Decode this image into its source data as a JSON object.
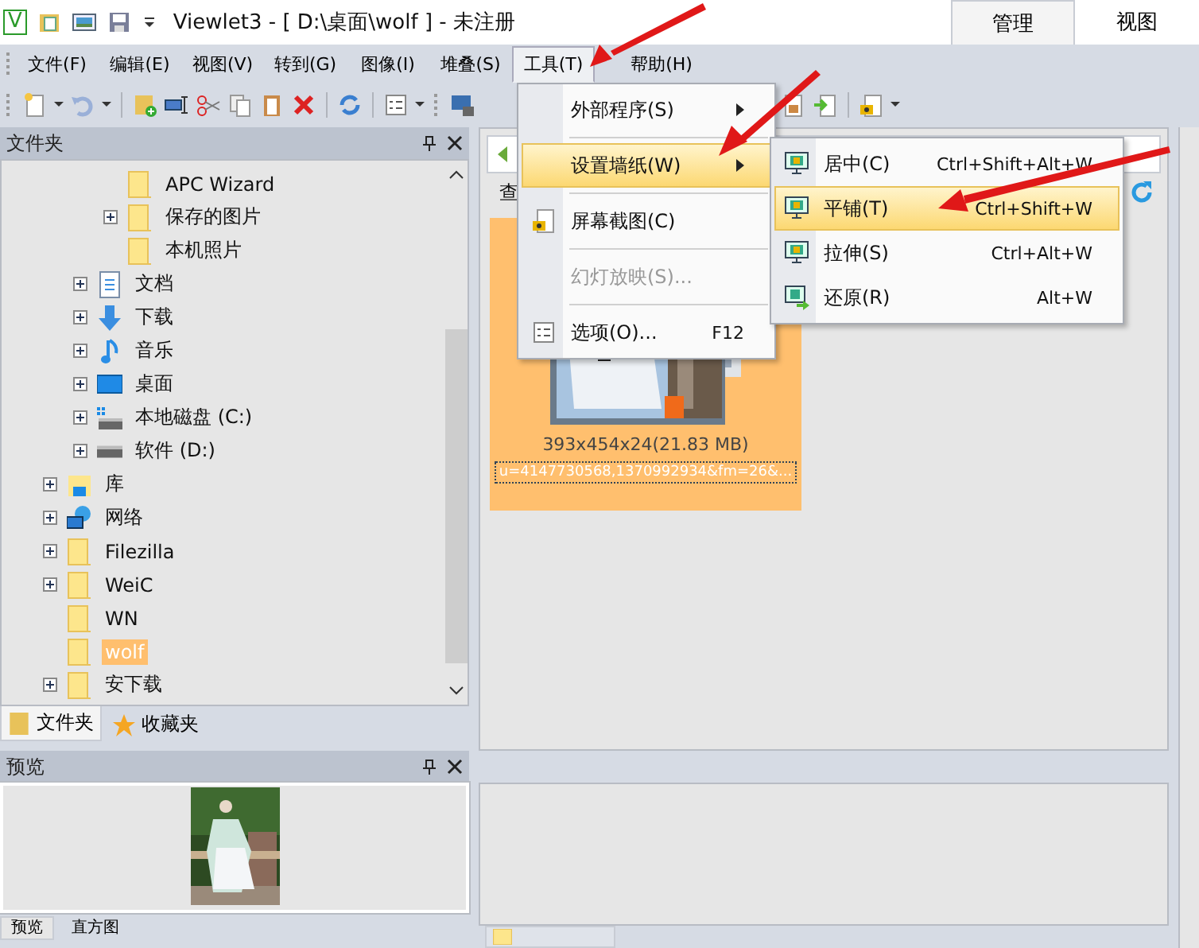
{
  "title_bar": {
    "logo": "V",
    "title": "Viewlet3 - [ D:\\桌面\\wolf ] - 未注册",
    "ribbon_tabs": [
      {
        "label": "管理",
        "selected": true
      },
      {
        "label": "视图",
        "selected": false
      }
    ]
  },
  "menu_bar": [
    {
      "label": "文件(F)",
      "selected": false
    },
    {
      "label": "编辑(E)",
      "selected": false
    },
    {
      "label": "视图(V)",
      "selected": false
    },
    {
      "label": "转到(G)",
      "selected": false
    },
    {
      "label": "图像(I)",
      "selected": false
    },
    {
      "label": "堆叠(S)",
      "selected": false
    },
    {
      "label": "工具(T)",
      "selected": true
    },
    {
      "label": "帮助(H)",
      "selected": false
    }
  ],
  "folder_panel": {
    "title": "文件夹",
    "tree": [
      {
        "children": [
          {
            "children": [
              {
                "label": "APC Wizard",
                "kind": "folder",
                "expander": false,
                "selected": false
              },
              {
                "label": "保存的图片",
                "kind": "folder",
                "expander": true,
                "selected": false
              },
              {
                "label": "本机照片",
                "kind": "folder",
                "expander": false,
                "selected": false
              }
            ]
          },
          {
            "label": "文档",
            "kind": "document",
            "expander": true,
            "selected": false
          },
          {
            "label": "下载",
            "kind": "download",
            "expander": true,
            "selected": false
          },
          {
            "label": "音乐",
            "kind": "music",
            "expander": true,
            "selected": false
          },
          {
            "label": "桌面",
            "kind": "desktop",
            "expander": true,
            "selected": false
          },
          {
            "label": "本地磁盘 (C:)",
            "kind": "system-drive",
            "expander": true,
            "selected": false
          },
          {
            "label": "软件 (D:)",
            "kind": "drive",
            "expander": true,
            "selected": false
          }
        ]
      },
      {
        "label": "库",
        "kind": "library",
        "expander": true,
        "selected": false
      },
      {
        "label": "网络",
        "kind": "network",
        "expander": true,
        "selected": false
      },
      {
        "label": "Filezilla",
        "kind": "folder",
        "expander": true,
        "selected": false
      },
      {
        "label": "WeiC",
        "kind": "folder",
        "expander": true,
        "selected": false
      },
      {
        "label": "WN",
        "kind": "folder",
        "expander": false,
        "selected": false
      },
      {
        "label": "wolf",
        "kind": "folder",
        "expander": false,
        "selected": true
      },
      {
        "label": "安下载",
        "kind": "folder",
        "expander": true,
        "selected": false
      }
    ],
    "tabs": [
      {
        "label": "文件夹",
        "kind": "folder",
        "selected": true
      },
      {
        "label": "收藏夹",
        "kind": "favorites",
        "selected": false
      }
    ]
  },
  "preview_panel": {
    "title": "预览",
    "tabs": [
      {
        "label": "预览",
        "selected": true
      },
      {
        "label": "直方图",
        "selected": false
      }
    ]
  },
  "browser": {
    "tab_label": "查",
    "thumbnail": {
      "selected": true,
      "info": "393x454x24(21.83 MB)",
      "filename": "u=4147730568,1370992934&fm=26&..."
    }
  },
  "tools_menu": [
    {
      "kind": "item",
      "label": "外部程序(S)",
      "submenu": true,
      "highlighted": false,
      "disabled": false
    },
    {
      "kind": "separator"
    },
    {
      "kind": "item",
      "label": "设置墙纸(W)",
      "submenu": true,
      "highlighted": true,
      "disabled": false
    },
    {
      "kind": "separator"
    },
    {
      "kind": "screenshot",
      "label": "屏幕截图(C)",
      "submenu": false,
      "highlighted": false,
      "disabled": false
    },
    {
      "kind": "separator"
    },
    {
      "kind": "item",
      "label": "幻灯放映(S)...",
      "submenu": false,
      "highlighted": false,
      "disabled": true
    },
    {
      "kind": "separator"
    },
    {
      "kind": "options",
      "label": "选项(O)...",
      "shortcut": "F12",
      "submenu": false,
      "highlighted": false,
      "disabled": false
    }
  ],
  "wallpaper_submenu": [
    {
      "label": "居中(C)",
      "shortcut": "Ctrl+Shift+Alt+W",
      "kind": "monitor",
      "highlighted": false
    },
    {
      "label": "平铺(T)",
      "shortcut": "Ctrl+Shift+W",
      "kind": "monitor",
      "highlighted": true
    },
    {
      "label": "拉伸(S)",
      "shortcut": "Ctrl+Alt+W",
      "kind": "monitor",
      "highlighted": false
    },
    {
      "label": "还原(R)",
      "shortcut": "Alt+W",
      "kind": "restore",
      "highlighted": false
    }
  ]
}
